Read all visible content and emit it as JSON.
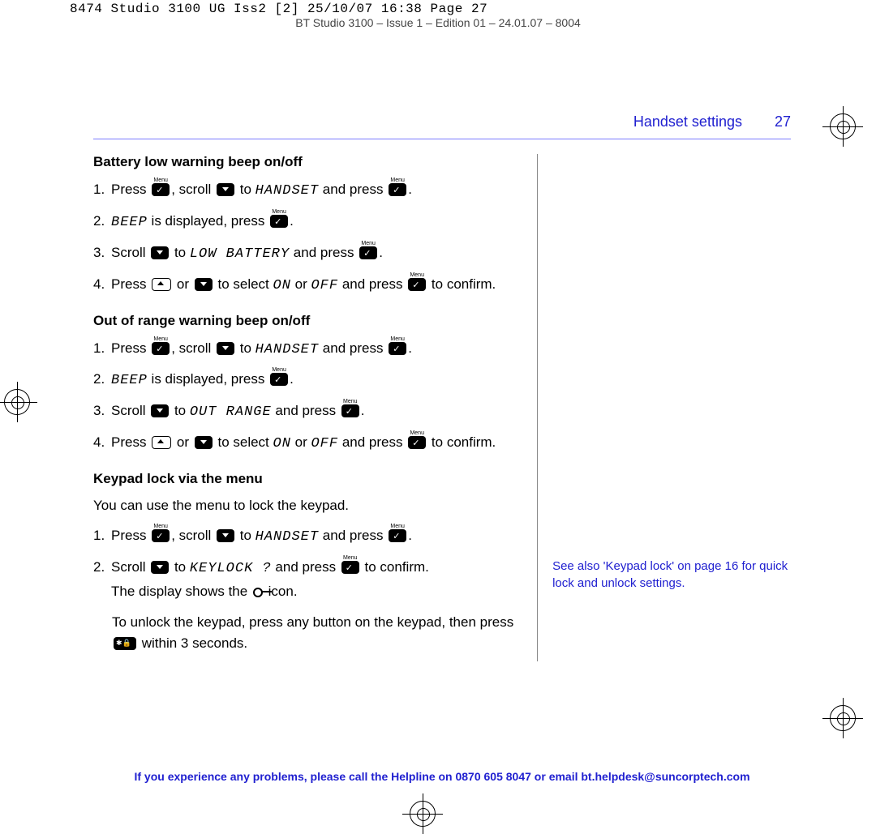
{
  "crop": "8474 Studio 3100 UG Iss2 [2]  25/10/07  16:38  Page 27",
  "ghost": "BT Studio 3100 – Issue 1 – Edition 01 – 24.01.07 – 8004",
  "header": {
    "section": "Handset settings",
    "page": "27"
  },
  "s1": {
    "title": "Battery low warning beep on/off",
    "t1a": "Press ",
    "t1b": ", scroll ",
    "t1c": " to ",
    "t1d": "HANDSET",
    "t1e": " and press ",
    "t1f": ".",
    "t2a": "BEEP",
    "t2b": " is displayed, press ",
    "t2c": ".",
    "t3a": "Scroll ",
    "t3b": " to ",
    "t3c": "LOW BATTERY",
    "t3d": " and press ",
    "t3e": ".",
    "t4a": "Press ",
    "t4b": " or ",
    "t4c": " to select ",
    "t4d": "ON",
    "t4e": " or ",
    "t4f": "OFF",
    "t4g": " and press ",
    "t4h": " to confirm."
  },
  "s2": {
    "title": "Out of range warning beep on/off",
    "t1a": "Press ",
    "t1b": ", scroll ",
    "t1c": " to ",
    "t1d": "HANDSET",
    "t1e": " and press ",
    "t1f": ".",
    "t2a": "BEEP",
    "t2b": " is displayed, press ",
    "t2c": ".",
    "t3a": "Scroll ",
    "t3b": " to ",
    "t3c": "OUT RANGE",
    "t3d": " and press ",
    "t3e": ".",
    "t4a": "Press ",
    "t4b": " or ",
    "t4c": " to select ",
    "t4d": "ON",
    "t4e": " or ",
    "t4f": "OFF",
    "t4g": " and press ",
    "t4h": " to confirm."
  },
  "s3": {
    "title": "Keypad lock via the menu",
    "intro": "You can use the menu to lock the keypad.",
    "t1a": "Press ",
    "t1b": ", scroll ",
    "t1c": " to ",
    "t1d": "HANDSET",
    "t1e": " and press ",
    "t1f": ".",
    "t2a": "Scroll ",
    "t2b": " to ",
    "t2c": "KEYLOCK ?",
    "t2d": " and press ",
    "t2e": " to confirm.",
    "t2f": "The display shows the ",
    "t2g": " icon.",
    "t3a": "To unlock the keypad, press any button on the keypad, then press ",
    "t3b": " within 3 seconds."
  },
  "sidenote": "See also 'Keypad lock' on page 16 for quick lock and unlock settings.",
  "footer": "If you experience any problems, please call the Helpline on 0870 605 8047 or email bt.helpdesk@suncorptech.com",
  "n1": "1.",
  "n2": "2.",
  "n3": "3.",
  "n4": "4."
}
